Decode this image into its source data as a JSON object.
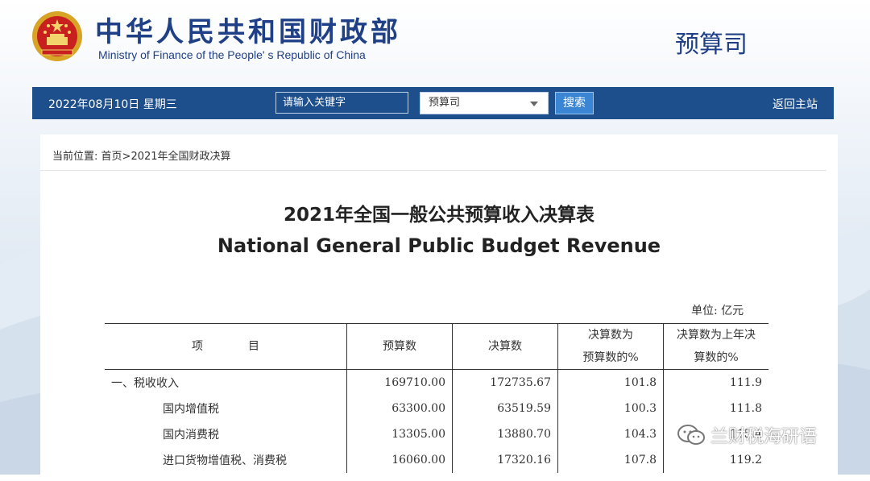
{
  "header": {
    "site_name_cn": "中华人民共和国财政部",
    "site_name_en": "Ministry of Finance of the People' s Republic of China",
    "department": "预算司"
  },
  "toolbar": {
    "date": "2022年08月10日  星期三",
    "search_placeholder": "请输入关键字",
    "select_value": "预算司",
    "search_button": "搜索",
    "home_link": "返回主站"
  },
  "breadcrumb": {
    "prefix": "当前位置:",
    "home": "首页",
    "separator": ">",
    "current": "2021年全国财政决算"
  },
  "report": {
    "title_cn": "2021年全国一般公共预算收入决算表",
    "title_en": "National General Public Budget Revenue",
    "unit": "单位: 亿元",
    "columns": [
      "项　　　　目",
      "预算数",
      "决算数",
      "决算数为\n预算数的%",
      "决算数为上年决\n算数的%"
    ],
    "rows": [
      {
        "item": "一、税收收入",
        "budget": "169710.00",
        "final": "172735.67",
        "pct_budget": "101.8",
        "pct_prev": "111.9"
      },
      {
        "item": "国内增值税",
        "budget": "63300.00",
        "final": "63519.59",
        "pct_budget": "100.3",
        "pct_prev": "111.8"
      },
      {
        "item": "国内消费税",
        "budget": "13305.00",
        "final": "13880.70",
        "pct_budget": "104.3",
        "pct_prev": "115.4"
      },
      {
        "item": "进口货物增值税、消费税",
        "budget": "16060.00",
        "final": "17320.16",
        "pct_budget": "107.8",
        "pct_prev": "119.2"
      }
    ]
  },
  "watermark": {
    "text": "兰财税海研语",
    "icon": "wechat-icon"
  },
  "colors": {
    "toolbar_bg": "#1d4f8c",
    "brand_blue": "#1f3f86",
    "button_blue": "#3a86d4"
  }
}
